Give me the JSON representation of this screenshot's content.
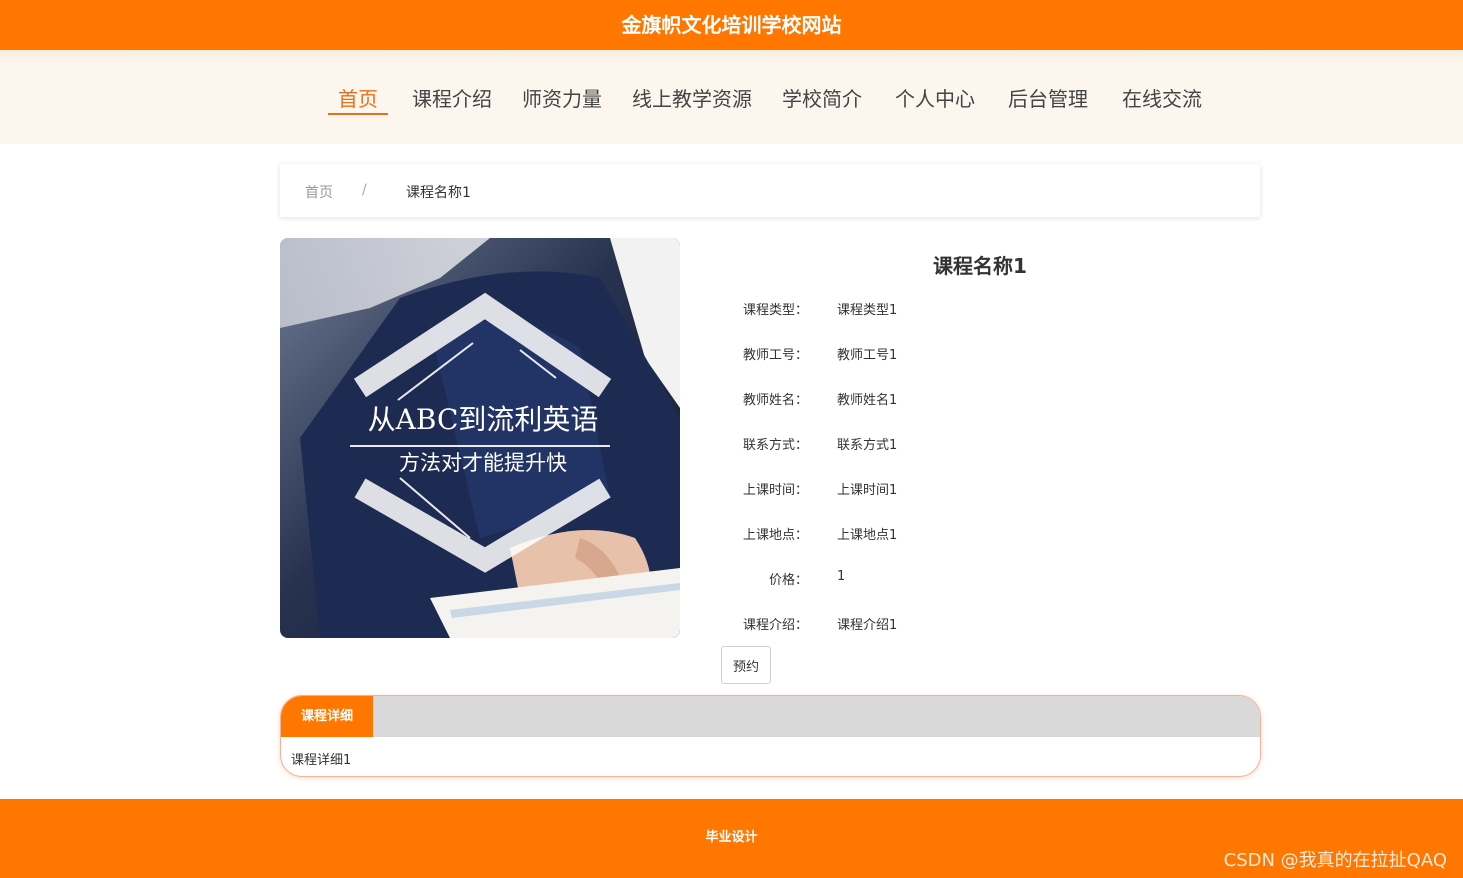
{
  "site": {
    "title": "金旗帜文化培训学校网站"
  },
  "nav": {
    "items": [
      {
        "label": "首页",
        "active": true
      },
      {
        "label": "课程介绍",
        "active": false
      },
      {
        "label": "师资力量",
        "active": false
      },
      {
        "label": "线上教学资源",
        "active": false
      },
      {
        "label": "学校简介",
        "active": false
      },
      {
        "label": "个人中心",
        "active": false
      },
      {
        "label": "后台管理",
        "active": false
      },
      {
        "label": "在线交流",
        "active": false
      }
    ]
  },
  "breadcrumb": {
    "home": "首页",
    "separator": "/",
    "current": "课程名称1"
  },
  "course": {
    "image_text": {
      "line1": "从ABC到流利英语",
      "line2": "方法对才能提升快"
    },
    "title": "课程名称1",
    "fields": [
      {
        "label": "课程类型：",
        "value": "课程类型1"
      },
      {
        "label": "教师工号：",
        "value": "教师工号1"
      },
      {
        "label": "教师姓名：",
        "value": "教师姓名1"
      },
      {
        "label": "联系方式：",
        "value": "联系方式1"
      },
      {
        "label": "上课时间：",
        "value": "上课时间1"
      },
      {
        "label": "上课地点：",
        "value": "上课地点1"
      },
      {
        "label": "价格：",
        "value": "1"
      },
      {
        "label": "课程介绍：",
        "value": "课程介绍1"
      }
    ],
    "book_label": "预约"
  },
  "detail": {
    "tab_label": "课程详细",
    "content": "课程详细1"
  },
  "footer": {
    "text": "毕业设计",
    "watermark": "CSDN @我真的在拉扯QAQ"
  },
  "colors": {
    "brand": "#ff7700",
    "nav_active": "#e8701a",
    "nav_bg": "#fdf6ee"
  }
}
